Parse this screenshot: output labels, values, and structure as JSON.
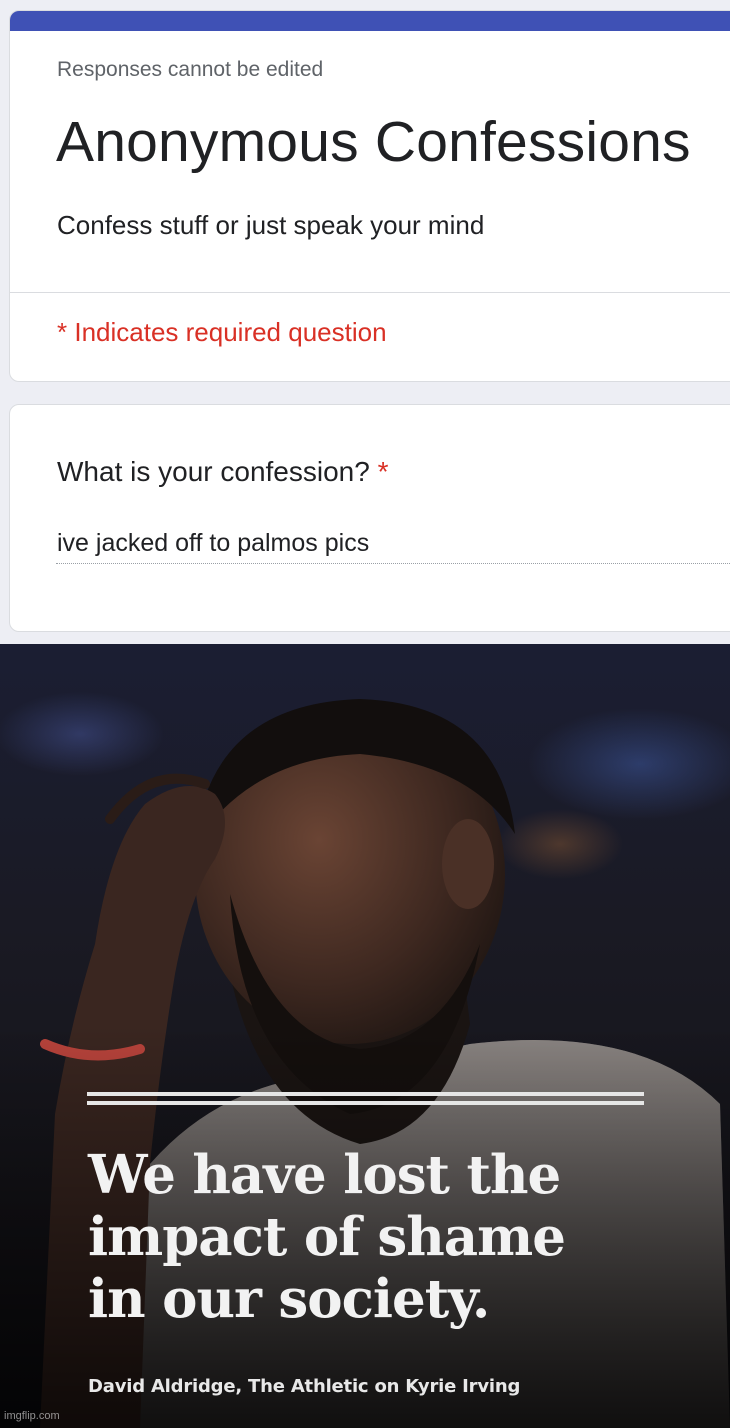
{
  "form": {
    "notice": "Responses cannot be edited",
    "title": "Anonymous Confessions",
    "description": "Confess stuff or just speak your mind",
    "required_note": "* Indicates required question",
    "accent_color": "#3f51b5",
    "required_color": "#d93025"
  },
  "question": {
    "label": "What is your confession?",
    "required_mark": "*",
    "answer": "ive jacked off to palmos pics"
  },
  "meme": {
    "quote_lines": [
      "We have lost the",
      "impact of shame",
      "in our society."
    ],
    "attribution": "David Aldridge, The Athletic on Kyrie Irving",
    "watermark": "imgflip.com"
  }
}
